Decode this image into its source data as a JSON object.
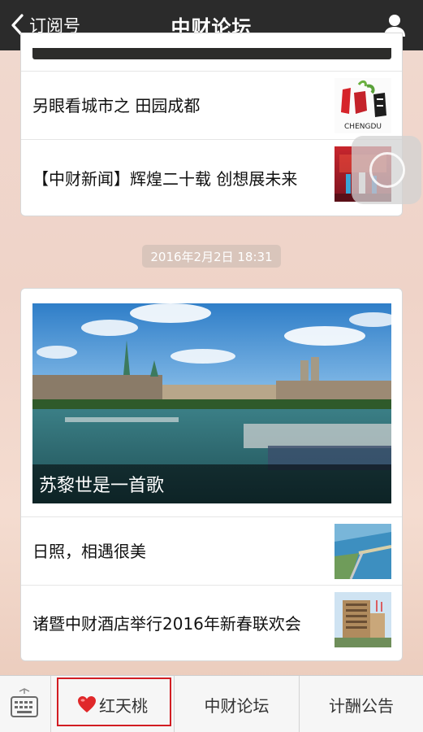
{
  "header": {
    "back_label": "订阅号",
    "title": "中财论坛"
  },
  "card_previous": {
    "items": [
      {
        "text": "另眼看城市之 田园成都",
        "thumb": "成都-logo-image",
        "thumb_text": "CHENGDU"
      },
      {
        "text": "【中财新闻】辉煌二十载 创想展未来",
        "thumb": "stage-event-image"
      }
    ]
  },
  "timestamp": "2016年2月2日 18:31",
  "card_main": {
    "hero": {
      "caption": "苏黎世是一首歌",
      "image": "zurich-river-photo"
    },
    "items": [
      {
        "text": "日照，相遇很美",
        "thumb": "coastline-aerial-image"
      },
      {
        "text": "诸暨中财酒店举行2016年新春联欢会",
        "thumb": "hotel-building-image"
      }
    ]
  },
  "bottom_bar": {
    "tabs": [
      {
        "label": "红天桃",
        "icon": "heart-icon"
      },
      {
        "label": "中财论坛"
      },
      {
        "label": "计酬公告"
      }
    ]
  },
  "colors": {
    "topbar": "#2b2b2b",
    "highlight_border": "#d21d23",
    "heart": "#e0282a"
  }
}
